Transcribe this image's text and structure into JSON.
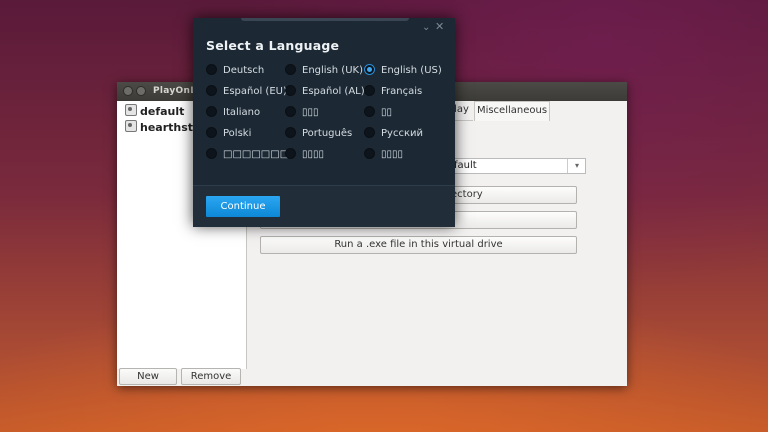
{
  "pol_window": {
    "title": "PlayOnL",
    "prefixes": [
      "default",
      "hearthstor"
    ],
    "new_button": "New",
    "remove_button": "Remove",
    "tabs": [
      "lay",
      "Miscellaneous"
    ],
    "wine_version_value": "fault",
    "buttons": [
      "ectory",
      "",
      "Run a .exe file in this virtual drive"
    ]
  },
  "language_dialog": {
    "title": "Select a Language",
    "minimize_glyph": "⌄",
    "close_glyph": "✕",
    "languages": [
      {
        "label": "Deutsch",
        "selected": false
      },
      {
        "label": "English (UK)",
        "selected": false
      },
      {
        "label": "English (US)",
        "selected": true
      },
      {
        "label": "Español (EU)",
        "selected": false
      },
      {
        "label": "Español (AL)",
        "selected": false
      },
      {
        "label": "Français",
        "selected": false
      },
      {
        "label": "Italiano",
        "selected": false
      },
      {
        "label": "▯▯▯",
        "selected": false
      },
      {
        "label": "▯▯",
        "selected": false
      },
      {
        "label": "Polski",
        "selected": false
      },
      {
        "label": "Português",
        "selected": false
      },
      {
        "label": "Русский",
        "selected": false
      },
      {
        "label": "□□□□□□□(",
        "selected": false
      },
      {
        "label": "▯▯▯▯",
        "selected": false
      },
      {
        "label": "▯▯▯▯",
        "selected": false
      }
    ],
    "continue_label": "Continue"
  }
}
